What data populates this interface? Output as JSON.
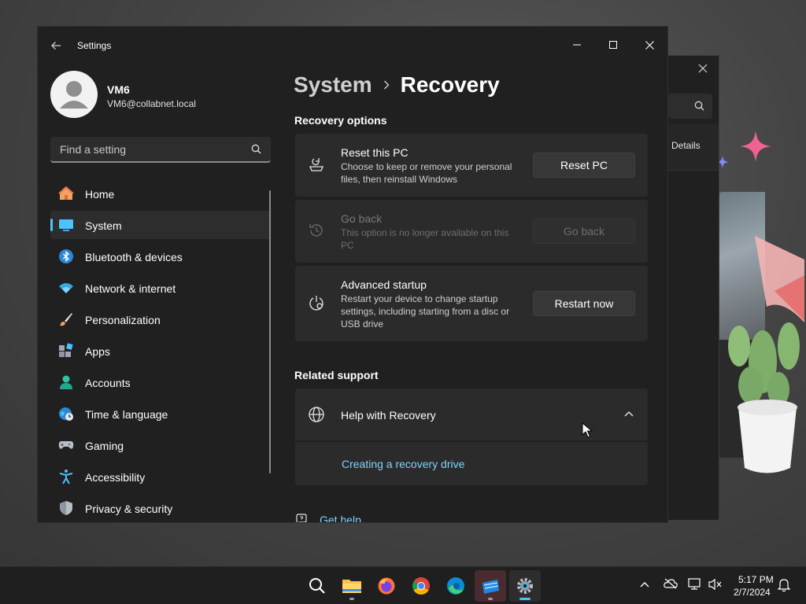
{
  "window": {
    "title": "Settings"
  },
  "profile": {
    "name": "VM6",
    "email": "VM6@collabnet.local"
  },
  "search": {
    "placeholder": "Find a setting"
  },
  "sidebar": {
    "items": [
      {
        "label": "Home",
        "icon": "home-icon"
      },
      {
        "label": "System",
        "icon": "system-icon",
        "active": true
      },
      {
        "label": "Bluetooth & devices",
        "icon": "bluetooth-icon"
      },
      {
        "label": "Network & internet",
        "icon": "wifi-icon"
      },
      {
        "label": "Personalization",
        "icon": "brush-icon"
      },
      {
        "label": "Apps",
        "icon": "apps-icon"
      },
      {
        "label": "Accounts",
        "icon": "accounts-icon"
      },
      {
        "label": "Time & language",
        "icon": "globe-clock-icon"
      },
      {
        "label": "Gaming",
        "icon": "gamepad-icon"
      },
      {
        "label": "Accessibility",
        "icon": "accessibility-icon"
      },
      {
        "label": "Privacy & security",
        "icon": "shield-icon"
      }
    ]
  },
  "breadcrumb": {
    "parent": "System",
    "current": "Recovery"
  },
  "recovery_options": {
    "heading": "Recovery options",
    "cards": [
      {
        "title": "Reset this PC",
        "description": "Choose to keep or remove your personal files, then reinstall Windows",
        "button": "Reset PC",
        "enabled": true
      },
      {
        "title": "Go back",
        "description": "This option is no longer available on this PC",
        "button": "Go back",
        "enabled": false
      },
      {
        "title": "Advanced startup",
        "description": "Restart your device to change startup settings, including starting from a disc or USB drive",
        "button": "Restart now",
        "enabled": true
      }
    ]
  },
  "related_support": {
    "heading": "Related support",
    "help_title": "Help with Recovery",
    "expanded": true,
    "link": "Creating a recovery drive"
  },
  "get_help": {
    "label": "Get help"
  },
  "back_window": {
    "tab_label": "Details"
  },
  "taskbar": {
    "apps": [
      "search-icon",
      "file-explorer-icon",
      "firefox-icon",
      "chrome-icon",
      "edge-icon",
      "app-icon",
      "settings-icon"
    ],
    "time": "5:17 PM",
    "date": "2/7/2024"
  },
  "colors": {
    "accent": "#4cc2ff",
    "link": "#7fd3ff",
    "background": "#202020",
    "card": "#2b2b2b"
  }
}
